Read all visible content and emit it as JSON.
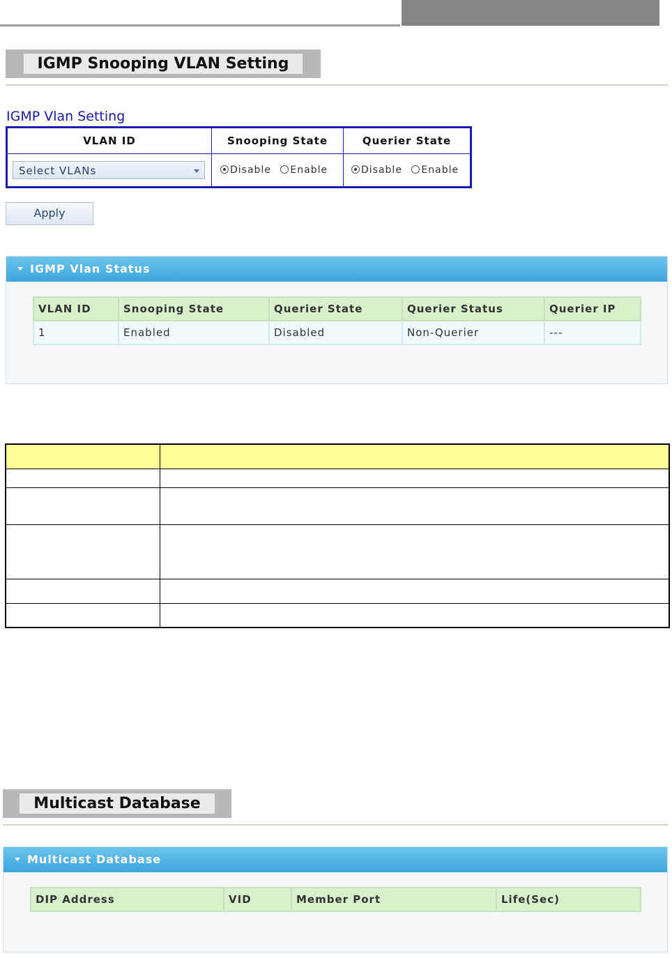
{
  "igmp_vlan_setting": {
    "page_title": "IGMP Snooping VLAN Setting",
    "section_label": "IGMP Vlan Setting",
    "columns": [
      "VLAN ID",
      "Snooping State",
      "Querier State"
    ],
    "vlan_select": "Select VLANs",
    "snooping_state": {
      "options": [
        "Disable",
        "Enable"
      ],
      "selected": "Disable"
    },
    "querier_state": {
      "options": [
        "Disable",
        "Enable"
      ],
      "selected": "Disable"
    },
    "apply_label": "Apply"
  },
  "igmp_vlan_status": {
    "panel_title": "IGMP Vlan Status",
    "columns": [
      "VLAN ID",
      "Snooping State",
      "Querier State",
      "Querier Status",
      "Querier IP"
    ],
    "rows": [
      [
        "1",
        "Enabled",
        "Disabled",
        "Non-Querier",
        "---"
      ]
    ]
  },
  "description_table": {
    "rows": 6
  },
  "multicast_database": {
    "page_title": "Multicast Database",
    "panel_title": "Multicast Database",
    "columns": [
      "DIP Address",
      "VID",
      "Member Port",
      "Life(Sec)"
    ]
  },
  "colors": {
    "header_blue": "#3ca6de",
    "table_border_blue": "#1c1cb0",
    "desc_header_yellow": "#ffff99",
    "grid_header_green": "#d8f0cc"
  }
}
